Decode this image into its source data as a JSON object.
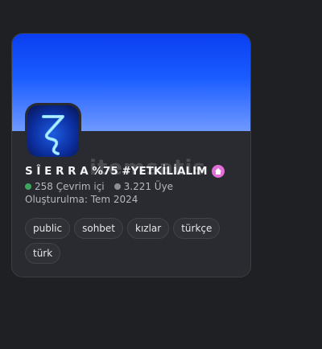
{
  "server": {
    "name": "S Î E R R A %75 #YETKİLİALIM",
    "online": "258 Çevrim içi",
    "members": "3.221 Üye",
    "created": "Oluşturulma: Tem 2024",
    "badge_icon": "house-icon"
  },
  "tags": [
    "public",
    "sohbet",
    "kızlar",
    "türkçe",
    "türk"
  ],
  "watermark": "itemsatis",
  "colors": {
    "banner": "#1a5cff",
    "online_dot": "#3fa55c",
    "members_dot": "#8a8e96",
    "badge": "#e26fd8"
  }
}
